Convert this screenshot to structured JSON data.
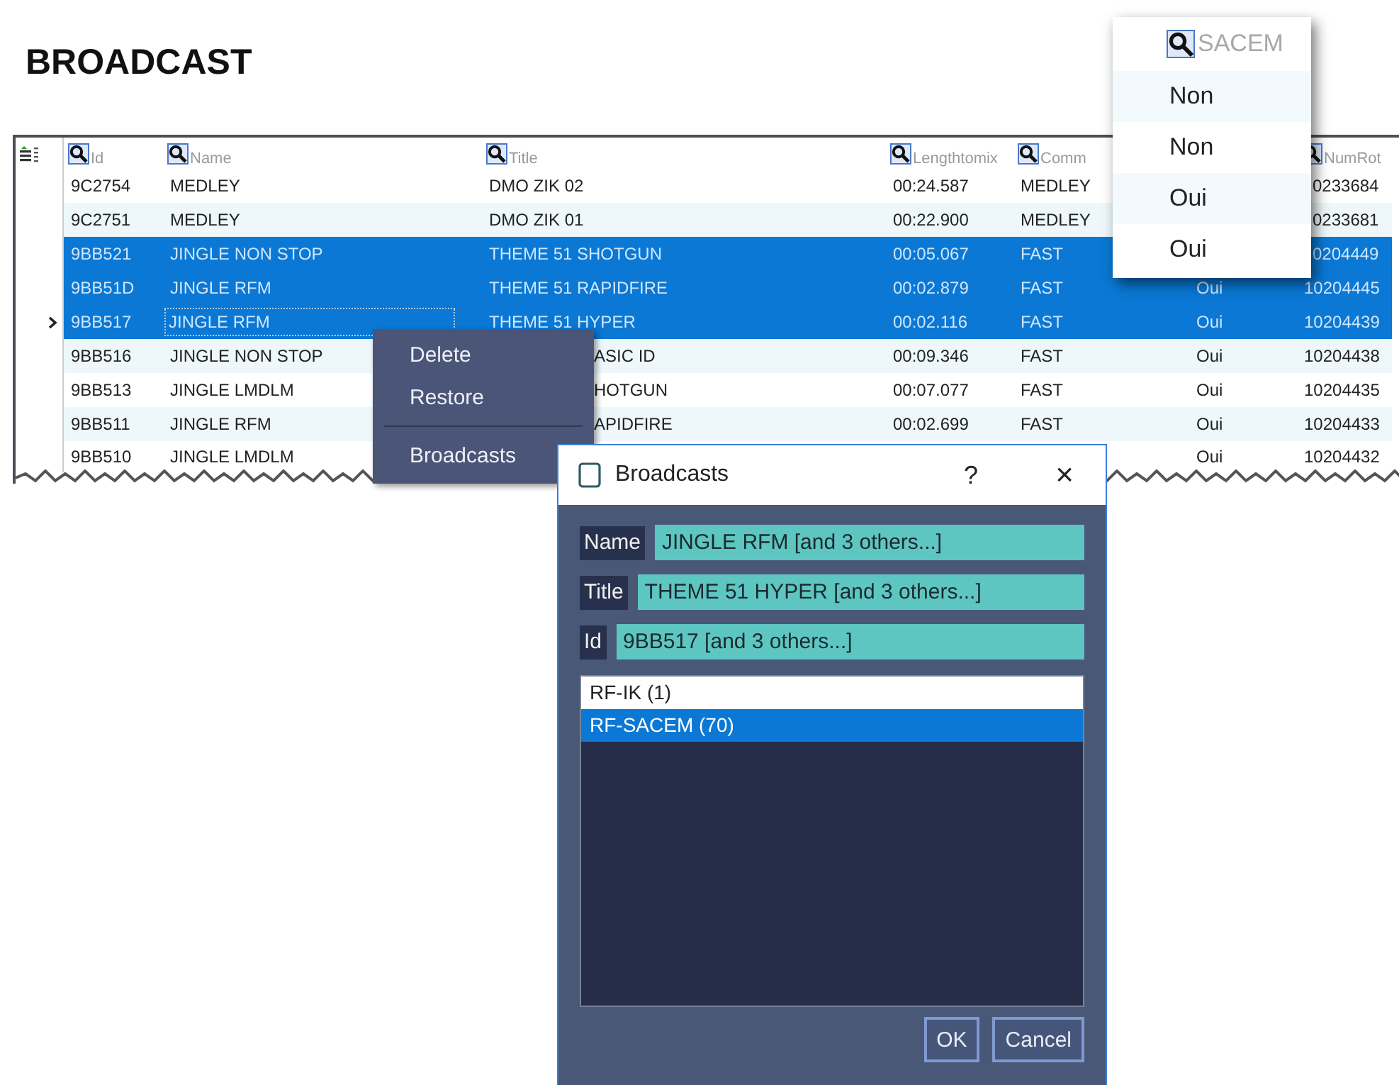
{
  "heading": "BROADCAST",
  "table": {
    "columns": [
      "Id",
      "Name",
      "Title",
      "Lengthtomix",
      "Comm",
      null,
      "NumRot"
    ],
    "rows": [
      {
        "selected": false,
        "current": false,
        "cells": [
          "9C2754",
          "MEDLEY",
          "DMO ZIK 02",
          "00:24.587",
          "MEDLEY",
          null,
          {
            "text": "0233684",
            "cut": true
          }
        ]
      },
      {
        "selected": false,
        "current": false,
        "cells": [
          "9C2751",
          "MEDLEY",
          "DMO ZIK 01",
          "00:22.900",
          "MEDLEY",
          null,
          {
            "text": "0233681",
            "cut": true
          }
        ]
      },
      {
        "selected": true,
        "current": false,
        "cells": [
          "9BB521",
          "JINGLE NON STOP",
          "THEME 51 SHOTGUN",
          "00:05.067",
          "FAST",
          null,
          {
            "text": "0204449",
            "cut": true
          }
        ]
      },
      {
        "selected": true,
        "current": false,
        "cells": [
          "9BB51D",
          "JINGLE RFM",
          "THEME 51 RAPIDFIRE",
          "00:02.879",
          "FAST",
          "Oui",
          "10204445"
        ]
      },
      {
        "selected": true,
        "current": true,
        "cells": [
          "9BB517",
          "JINGLE RFM",
          "THEME 51 HYPER",
          "00:02.116",
          "FAST",
          "Oui",
          "10204439"
        ]
      },
      {
        "selected": false,
        "current": false,
        "cells": [
          "9BB516",
          "JINGLE NON STOP",
          {
            "text": "ASIC ID",
            "cut": true
          },
          "00:09.346",
          "FAST",
          "Oui",
          "10204438"
        ]
      },
      {
        "selected": false,
        "current": false,
        "cells": [
          "9BB513",
          "JINGLE LMDLM",
          {
            "text": "HOTGUN",
            "cut": true
          },
          "00:07.077",
          "FAST",
          "Oui",
          "10204435"
        ]
      },
      {
        "selected": false,
        "current": false,
        "cells": [
          "9BB511",
          "JINGLE RFM",
          {
            "text": "APIDFIRE",
            "cut": true
          },
          "00:02.699",
          "FAST",
          "Oui",
          "10204433"
        ]
      },
      {
        "selected": false,
        "current": false,
        "cells": [
          "9BB510",
          "JINGLE LMDLM",
          null,
          null,
          null,
          "Oui",
          "10204432"
        ]
      }
    ]
  },
  "column_popup": {
    "header": "SACEM",
    "items": [
      "Non",
      "Non",
      "Oui",
      "Oui"
    ]
  },
  "context_menu": {
    "items": [
      {
        "kind": "item",
        "label": "Delete"
      },
      {
        "kind": "item",
        "label": "Restore"
      },
      {
        "kind": "separator"
      },
      {
        "kind": "item",
        "label": "Broadcasts"
      }
    ]
  },
  "dialog": {
    "title": "Broadcasts",
    "help": "?",
    "close": "×",
    "fields": [
      {
        "label": "Name",
        "value": "JINGLE RFM [and 3 others...]"
      },
      {
        "label": "Title",
        "value": "THEME 51 HYPER [and 3 others...]"
      },
      {
        "label": "Id",
        "value": "9BB517 [and 3 others...]"
      }
    ],
    "list": [
      {
        "label": "RF-IK (1)",
        "selected": false
      },
      {
        "label": "RF-SACEM (70)",
        "selected": true
      }
    ],
    "buttons": [
      "OK",
      "Cancel"
    ]
  }
}
